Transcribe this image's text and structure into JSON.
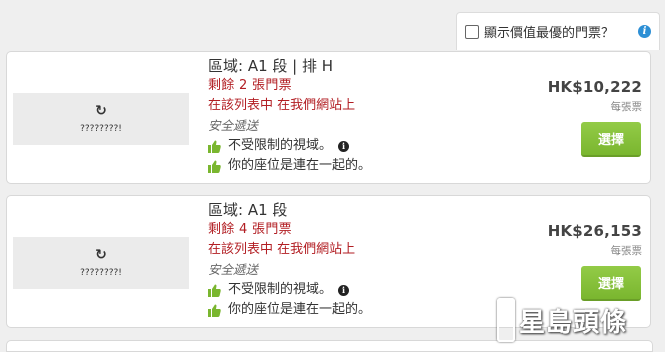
{
  "filter": {
    "label": "顯示價值最優的門票？",
    "info": "i"
  },
  "listings": [
    {
      "zone": "區域: A1 段 | 排 H",
      "remaining": "剩餘 2 張門票",
      "listed": "在該列表中 在我們網站上",
      "delivery": "安全遞送",
      "feature1": "不受限制的視域。",
      "feature2": "你的座位是連在一起的。",
      "map_placeholder": "????????!",
      "price": "HK$10,222",
      "per_ticket": "每張票",
      "select_label": "選擇"
    },
    {
      "zone": "區域: A1 段",
      "remaining": "剩餘 4 張門票",
      "listed": "在該列表中 在我們網站上",
      "delivery": "安全遞送",
      "feature1": "不受限制的視域。",
      "feature2": "你的座位是連在一起的。",
      "map_placeholder": "????????!",
      "price": "HK$26,153",
      "per_ticket": "每張票",
      "select_label": "選擇"
    }
  ],
  "watermark": "星島頭條",
  "colors": {
    "accent_green": "#85c03a",
    "alert_red": "#b21e23",
    "info_blue": "#2d8fd5"
  },
  "icons": {
    "refresh": "refresh-icon",
    "thumbs_up": "thumbs-up-icon",
    "info": "info-icon"
  }
}
